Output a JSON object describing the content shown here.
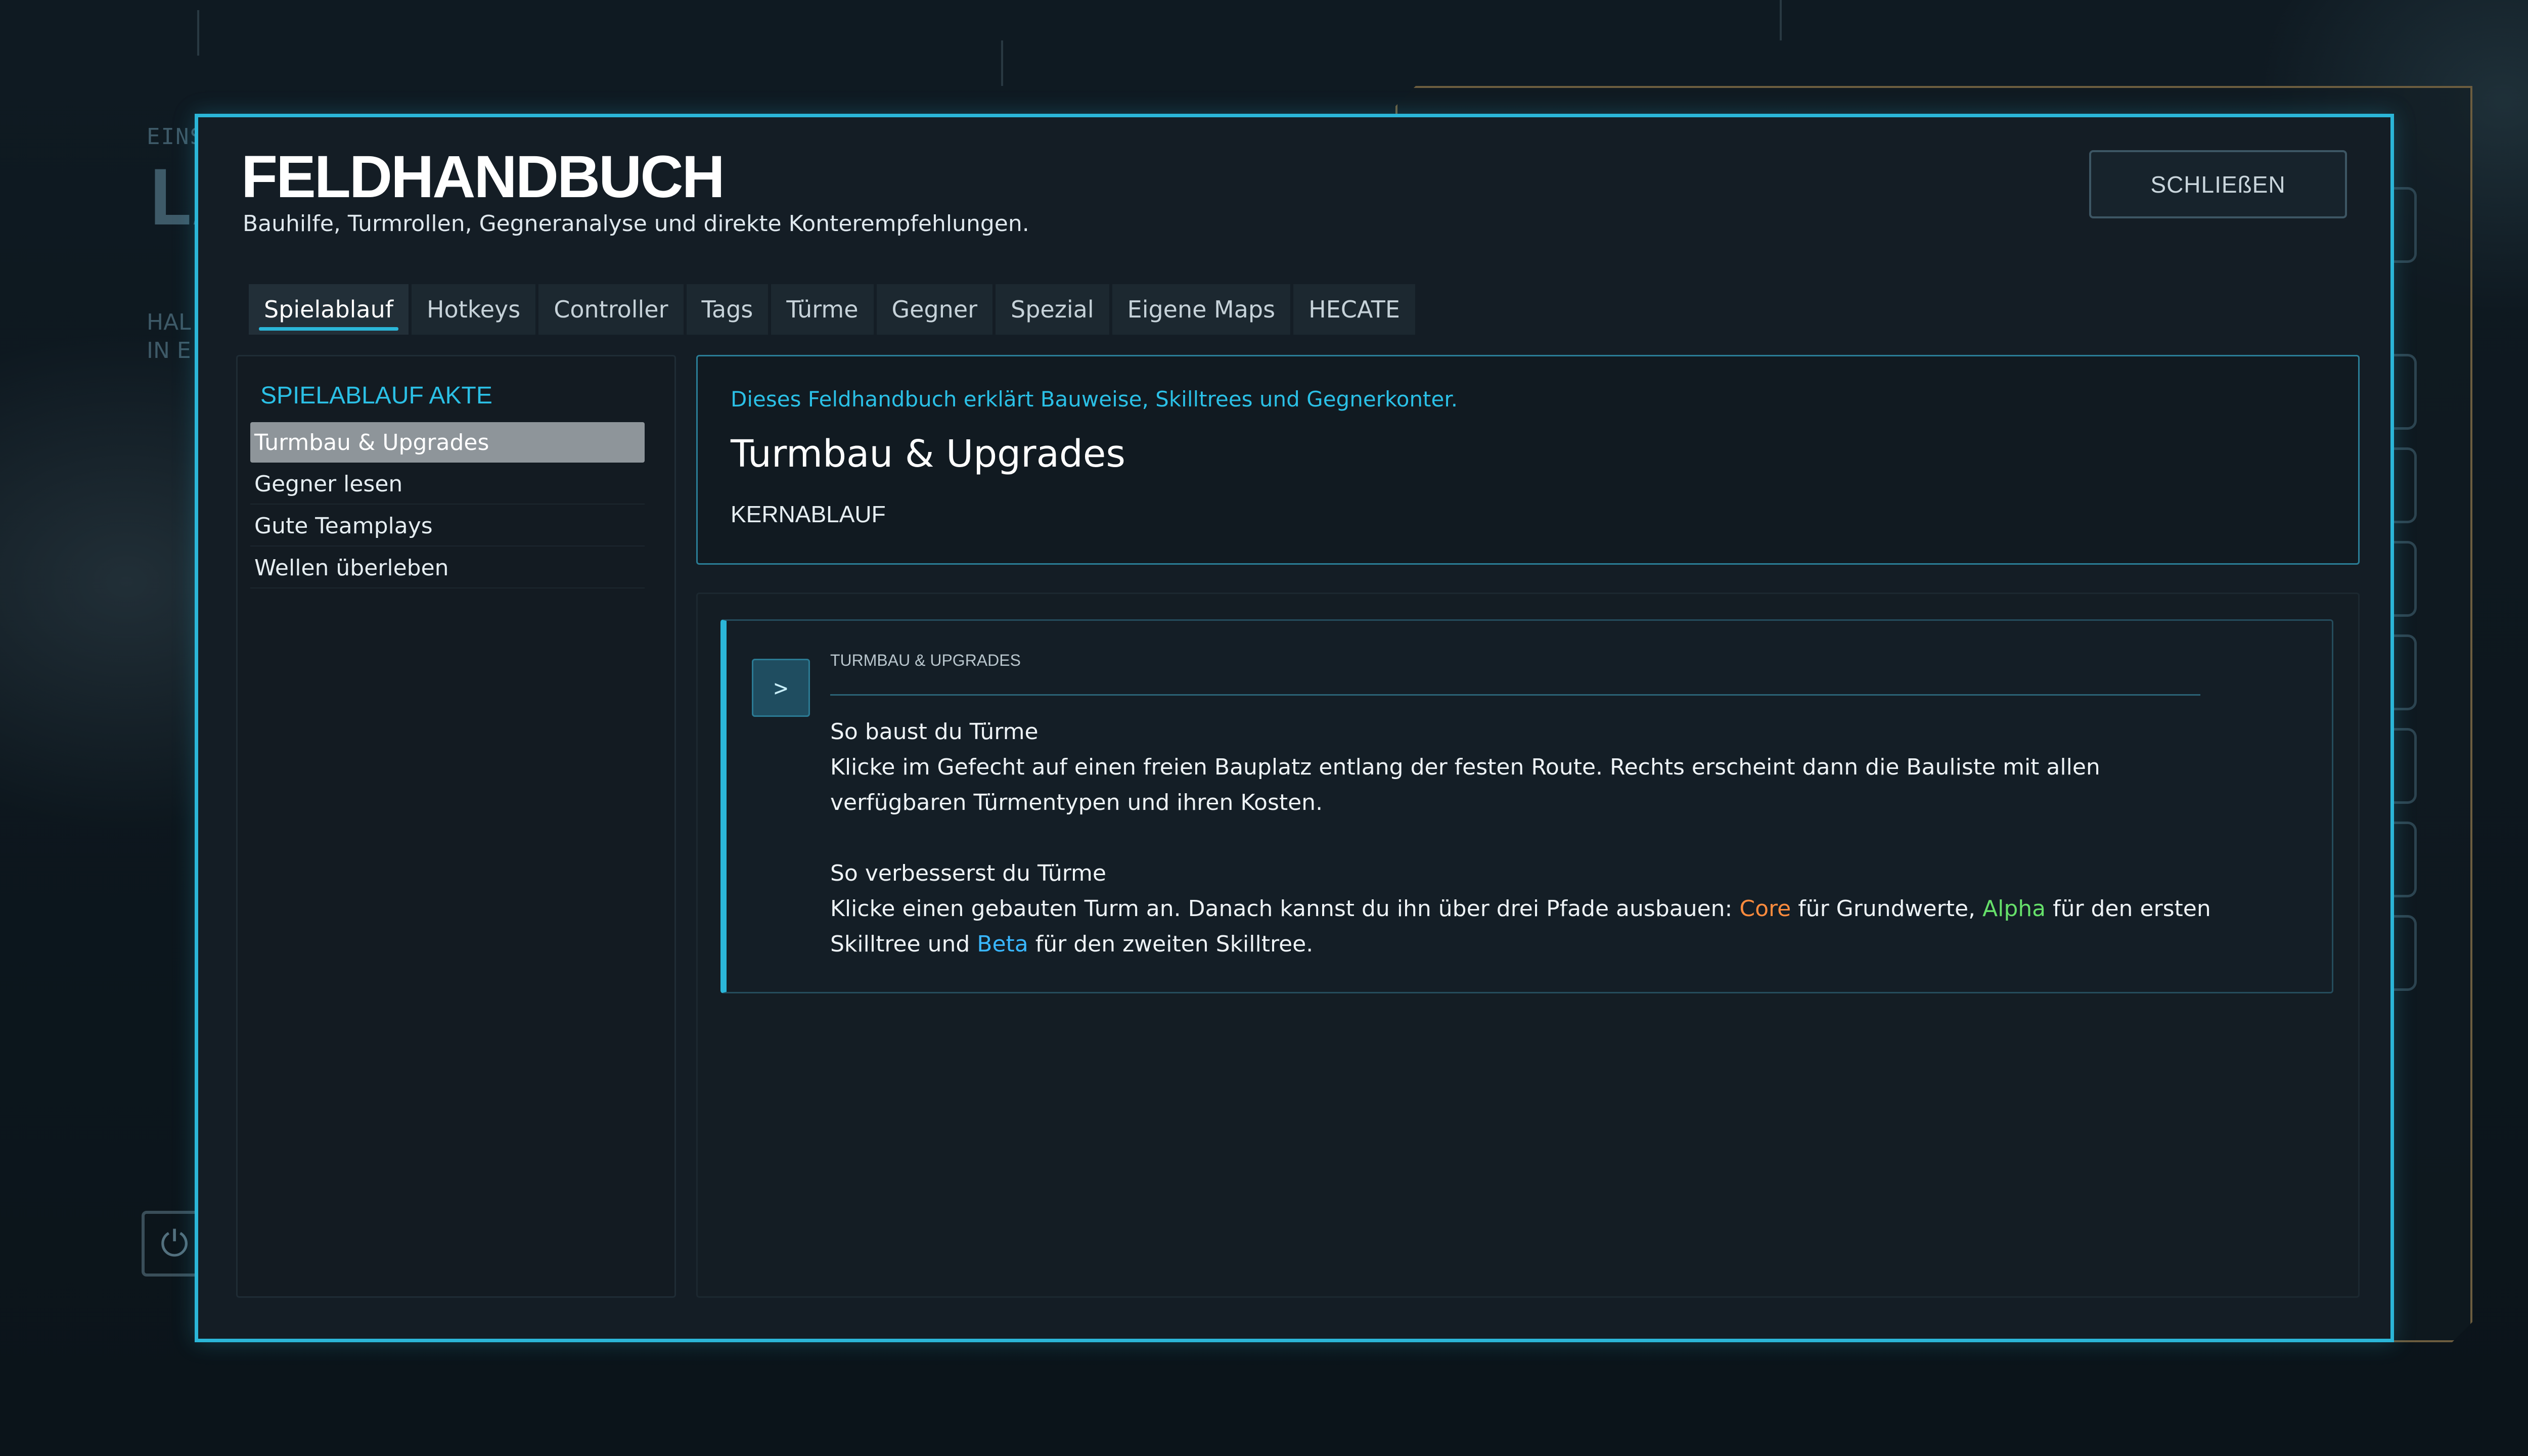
{
  "background": {
    "behind_small": "EINS",
    "behind_large": "LA",
    "behind_sub": [
      "HAL",
      "IN E"
    ]
  },
  "dialog": {
    "title": "FELDHANDBUCH",
    "subtitle": "Bauhilfe, Turmrollen, Gegneranalyse und direkte Konterempfehlungen.",
    "close_label": "SCHLIEßEN"
  },
  "tabs": [
    {
      "label": "Spielablauf",
      "active": true
    },
    {
      "label": "Hotkeys",
      "active": false
    },
    {
      "label": "Controller",
      "active": false
    },
    {
      "label": "Tags",
      "active": false
    },
    {
      "label": "Türme",
      "active": false
    },
    {
      "label": "Gegner",
      "active": false
    },
    {
      "label": "Spezial",
      "active": false
    },
    {
      "label": "Eigene Maps",
      "active": false
    },
    {
      "label": "HECATE",
      "active": false
    }
  ],
  "sidebar": {
    "heading": "SPIELABLAUF AKTE",
    "items": [
      {
        "label": "Turmbau & Upgrades",
        "active": true
      },
      {
        "label": "Gegner lesen",
        "active": false
      },
      {
        "label": "Gute Teamplays",
        "active": false
      },
      {
        "label": "Wellen überleben",
        "active": false
      }
    ]
  },
  "header": {
    "intro": "Dieses Feldhandbuch erklärt Bauweise, Skilltrees und Gegnerkonter.",
    "title": "Turmbau & Upgrades",
    "tag": "KERNABLAUF"
  },
  "entry": {
    "icon_glyph": ">",
    "label": "TURMBAU & UPGRADES",
    "section1_title": "So baust du Türme",
    "section1_text": "Klicke im Gefecht auf einen freien Bauplatz entlang der festen Route. Rechts erscheint dann die Bauliste mit allen verfügbaren Türmentypen und ihren Kosten.",
    "section2_title": "So verbesserst du Türme",
    "section2_pre": "Klicke einen gebauten Turm an. Danach kannst du ihn über drei Pfade ausbauen: ",
    "core": "Core",
    "core_mid": " für Grundwerte, ",
    "alpha": "Alpha",
    "alpha_mid": " für den ersten Skilltree und ",
    "beta": "Beta",
    "beta_end": " für den zweiten Skilltree."
  },
  "colors": {
    "accent": "#2bb6d8",
    "core": "#ff8b3d",
    "alpha": "#66e06a",
    "beta": "#39b7ff"
  }
}
